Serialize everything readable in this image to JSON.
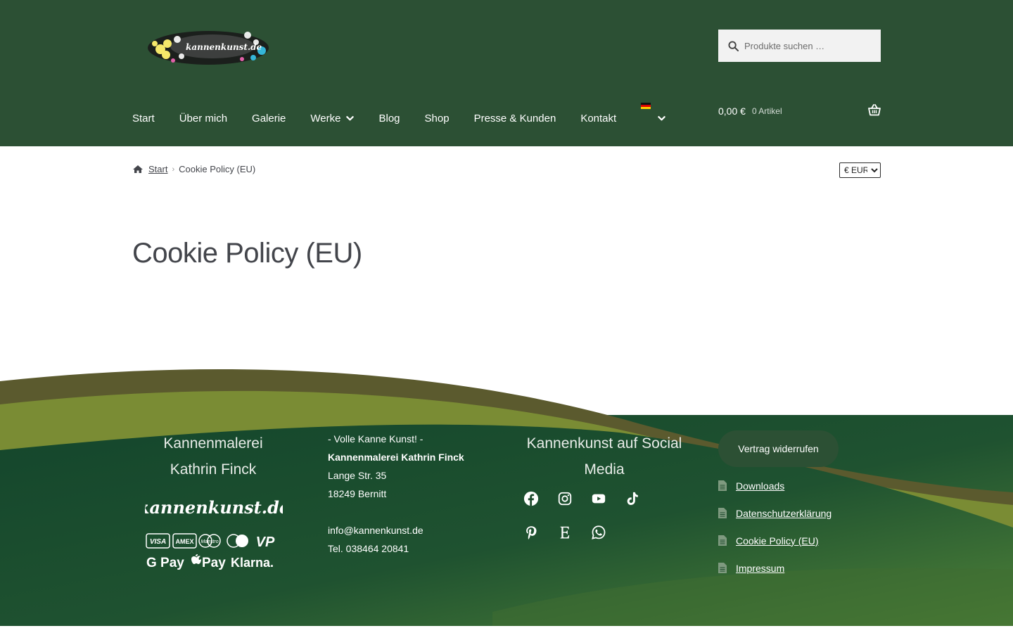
{
  "brand": {
    "logo_text": "kannenkunst.de",
    "colors": {
      "header_green": "#2c5034",
      "footer_dark": "#1d4a2c",
      "footer_olive": "#7a8c34",
      "footer_light": "#4e7a36"
    }
  },
  "search": {
    "placeholder": "Produkte suchen …",
    "icon": "search-icon"
  },
  "nav": {
    "items": [
      {
        "label": "Start"
      },
      {
        "label": "Über mich"
      },
      {
        "label": "Galerie"
      },
      {
        "label": "Werke",
        "has_dropdown": true
      },
      {
        "label": "Blog"
      },
      {
        "label": "Shop"
      },
      {
        "label": "Presse & Kunden"
      },
      {
        "label": "Kontakt"
      }
    ],
    "language": {
      "flag": "german-flag-icon",
      "has_dropdown": true
    }
  },
  "cart": {
    "amount": "0,00 €",
    "count": "0 Artikel",
    "icon": "basket-icon"
  },
  "breadcrumb": {
    "home": "Start",
    "current": "Cookie Policy (EU)"
  },
  "currency": {
    "selected": "€ EUR",
    "options": [
      "€ EUR"
    ]
  },
  "page": {
    "title": "Cookie Policy (EU)"
  },
  "footer": {
    "col1": {
      "title_line1": "Kannenmalerei",
      "title_line2": "Kathrin Finck",
      "script_logo": "kannenkunst.de"
    },
    "payments": [
      "VISA",
      "AMEX",
      "Maestro",
      "Mastercard",
      "VP",
      "G Pay",
      "Apple Pay",
      "Klarna."
    ],
    "address": {
      "tagline": "- Volle Kanne Kunst! -",
      "company": "Kannenmalerei Kathrin Finck",
      "street": "Lange Str. 35",
      "city": "18249 Bernitt",
      "email": "info@kannenkunst.de",
      "phone": "Tel. 038464 20841"
    },
    "social": {
      "title_line1": "Kannenkunst auf Social",
      "title_line2": "Media",
      "icons": [
        "facebook-icon",
        "instagram-icon",
        "youtube-icon",
        "tiktok-icon",
        "pinterest-icon",
        "etsy-icon",
        "whatsapp-icon"
      ]
    },
    "withdraw_button": "Vertrag widerrufen",
    "legal_links": [
      "Downloads",
      "Datenschutzerklärung",
      "Cookie Policy (EU)",
      "Impressum"
    ]
  }
}
